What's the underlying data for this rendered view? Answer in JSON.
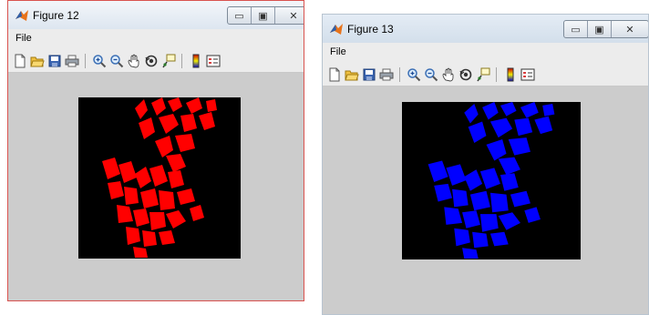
{
  "windows": [
    {
      "title": "Figure 12",
      "menu": "File",
      "blob_color": "#ff0000",
      "state": "active"
    },
    {
      "title": "Figure 13",
      "menu": "File",
      "blob_color": "#0000ff",
      "state": "inactive"
    }
  ],
  "caption_buttons": [
    "minimize-icon",
    "maximize-icon",
    "close-icon"
  ],
  "toolbar_icons": [
    "new-figure-icon",
    "open-file-icon",
    "save-icon",
    "print-icon",
    "zoom-in-icon",
    "zoom-out-icon",
    "pan-icon",
    "rotate-3d-icon",
    "data-cursor-icon",
    "colorbar-icon",
    "legend-icon"
  ]
}
